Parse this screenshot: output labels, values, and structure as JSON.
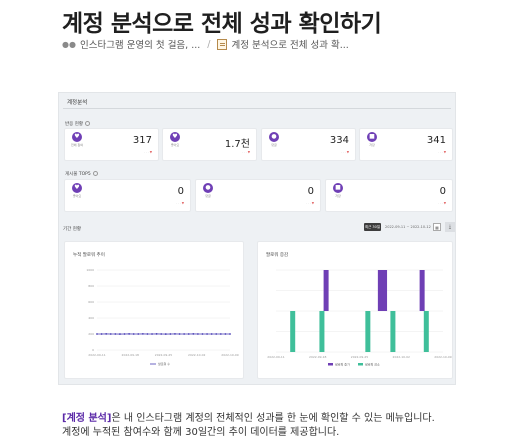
{
  "page": {
    "title": "계정 분석으로 전체 성과 확인하기",
    "breadcrumb": [
      {
        "icon": "sprout-icon",
        "label": "인스타그램 운영의 첫 걸음, ..."
      },
      {
        "icon": "memo-icon",
        "label": "계정 분석으로 전체 성과 확..."
      }
    ],
    "caption": {
      "highlight": "[계정 분석]",
      "line1_rest": "은 내 인스타그램 계정의 전체적인 성과를 한 눈에 확인할 수 있는 메뉴입니다.",
      "line2": "계정에 누적된 참여수와 함께 30일간의 추이 데이터를 제공합니다."
    }
  },
  "dashboard": {
    "title": "계정분석",
    "section_reaction": "반응 현황",
    "section_top5": "게시물 TOP5",
    "section_period": "기간 현황",
    "stat_cards": [
      {
        "icon": "heart-icon",
        "label": "전체 참여",
        "value": "317"
      },
      {
        "icon": "heart-icon",
        "label": "좋아요",
        "value": "1.7천"
      },
      {
        "icon": "comment-icon",
        "label": "댓글",
        "value": "334"
      },
      {
        "icon": "bookmark-icon",
        "label": "저장",
        "value": "341"
      }
    ],
    "top_cards": [
      {
        "icon": "heart-icon",
        "label": "좋아요",
        "value": "0"
      },
      {
        "icon": "comment-icon",
        "label": "댓글",
        "value": "0"
      },
      {
        "icon": "bookmark-icon",
        "label": "저장",
        "value": "0"
      }
    ],
    "recent_button": "최근 30일",
    "date_range": "2022-09-11 ~ 2022-10-12",
    "colors": {
      "accent": "#6f3fb5",
      "teal": "#3fbf9a",
      "line": "#4a3fb5"
    }
  },
  "chart_data": [
    {
      "type": "line",
      "title": "누적 팔로워 추이",
      "x": [
        "2022-09-11",
        "2022-09-18",
        "2022-09-25",
        "2022-10-02",
        "2022-10-09"
      ],
      "series": [
        {
          "name": "팔로워 수",
          "values": [
            200,
            200,
            201,
            200,
            200,
            199,
            200,
            201,
            200,
            200,
            202,
            200,
            200,
            201,
            200,
            199,
            200,
            201,
            200,
            200,
            200,
            201,
            200,
            200,
            200,
            200,
            200,
            200,
            200,
            200
          ]
        }
      ],
      "ylim": [
        0,
        1000
      ],
      "grid": true,
      "legend": "bottom"
    },
    {
      "type": "bar",
      "title": "팔로워 증감",
      "series": [
        {
          "name": "팔로워 증가",
          "color": "#6f3fb5",
          "points": [
            {
              "x": 12,
              "y": 1
            },
            {
              "x": 25,
              "y": 1
            },
            {
              "x": 26,
              "y": 1
            },
            {
              "x": 35,
              "y": 1
            }
          ]
        },
        {
          "name": "팔로워 감소",
          "color": "#3fbf9a",
          "points": [
            {
              "x": 4,
              "y": -1
            },
            {
              "x": 11,
              "y": -1
            },
            {
              "x": 22,
              "y": -1
            },
            {
              "x": 28,
              "y": -1
            },
            {
              "x": 36,
              "y": -1
            }
          ]
        }
      ],
      "xlim": [
        0,
        40
      ],
      "ylim": [
        -1,
        1
      ],
      "grid": true,
      "legend": "bottom"
    }
  ]
}
